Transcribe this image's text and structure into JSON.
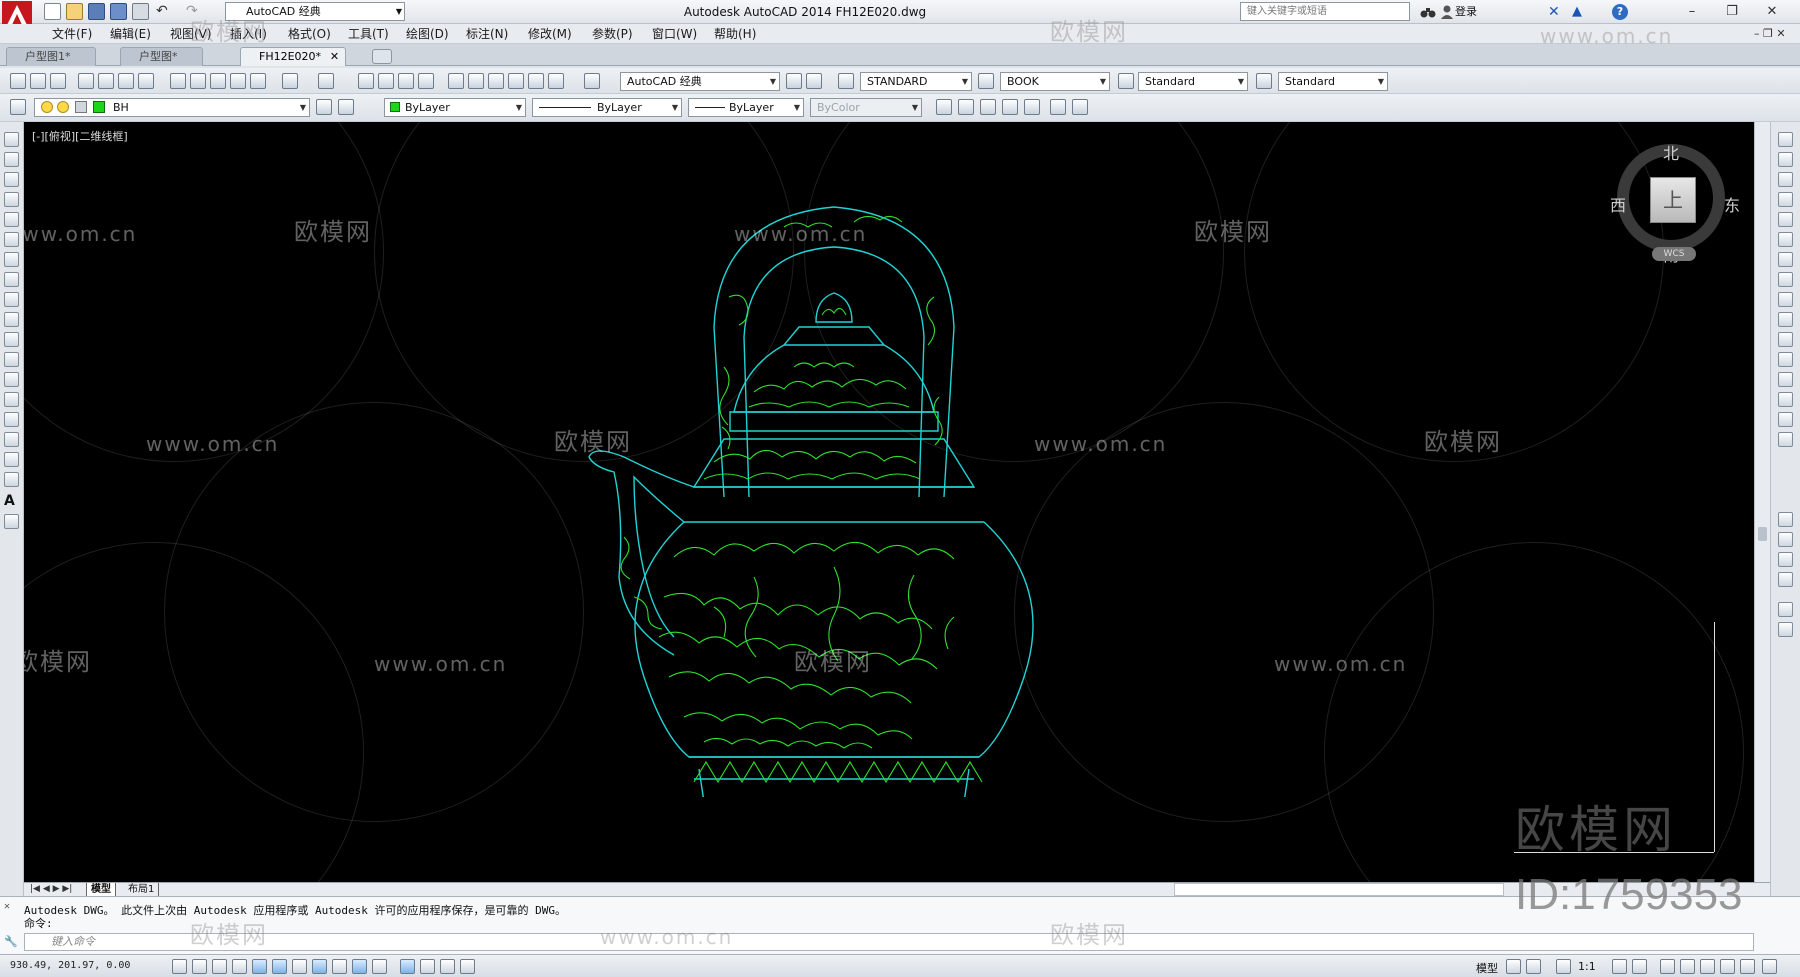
{
  "title_bar": {
    "workspace": "AutoCAD 经典",
    "window_title": "Autodesk AutoCAD 2014    FH12E020.dwg",
    "search_placeholder": "键入关键字或短语",
    "login": "登录"
  },
  "menu": [
    "文件(F)",
    "编辑(E)",
    "视图(V)",
    "插入(I)",
    "格式(O)",
    "工具(T)",
    "绘图(D)",
    "标注(N)",
    "修改(M)",
    "参数(P)",
    "窗口(W)",
    "帮助(H)"
  ],
  "file_tabs": [
    {
      "label": "户型图1*"
    },
    {
      "label": "户型图*"
    },
    {
      "label": "FH12E020*"
    }
  ],
  "toolbar_combos": {
    "workspace": "AutoCAD 经典",
    "text_style": "STANDARD",
    "dim_style": "BOOK",
    "table_style": "Standard",
    "mleader_style": "Standard",
    "layer": "BH",
    "color": "ByLayer",
    "linetype": "ByLayer",
    "lineweight": "ByLayer",
    "plotstyle": "ByColor"
  },
  "viewport_label": "[-][俯视][二维线框]",
  "viewcube": {
    "top_face": "上",
    "north": "北",
    "south": "南",
    "east": "东",
    "west": "西",
    "wcs": "WCS"
  },
  "layout_tabs": [
    "模型",
    "布局1"
  ],
  "command_line": {
    "history_1": "Autodesk DWG。  此文件上次由 Autodesk 应用程序或 Autodesk 许可的应用程序保存，是可靠的 DWG。",
    "history_2": "命令:",
    "input_placeholder": "键入命令"
  },
  "status": {
    "coordinates": "930.49, 201.97, 0.00",
    "model_label": "模型",
    "scale": "1:1"
  },
  "watermark": {
    "brand": "欧模网",
    "url": "www.om.cn",
    "id": "ID:1759353"
  },
  "colors": {
    "canvas": "#000000",
    "outline": "#22d3d3",
    "pattern": "#2ee02e"
  }
}
